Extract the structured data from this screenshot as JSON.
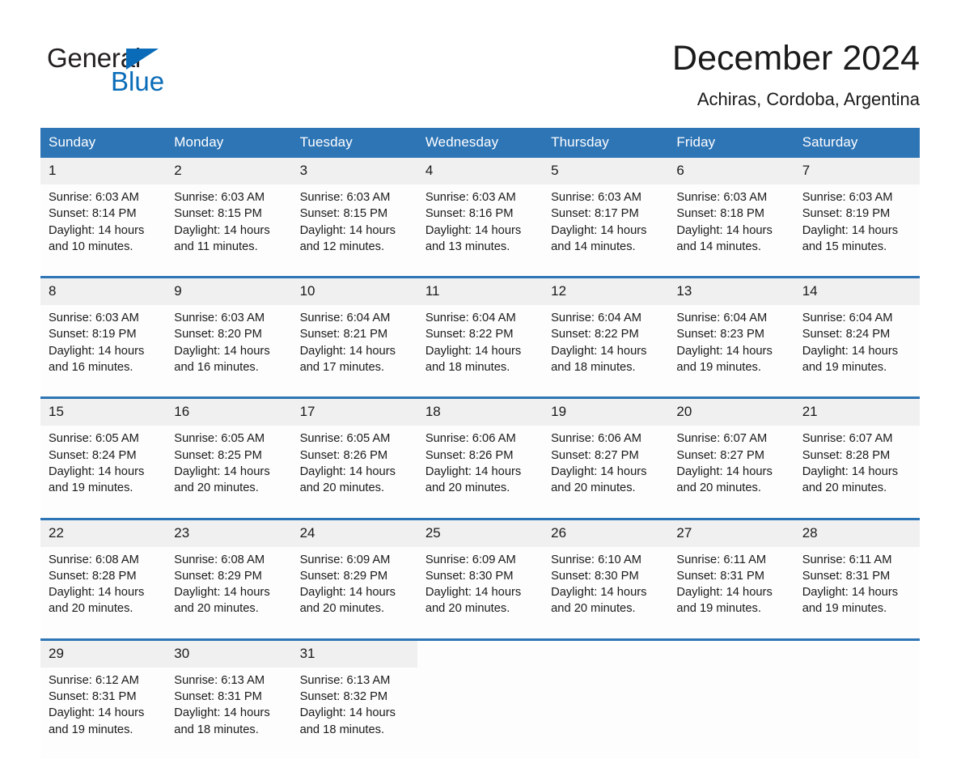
{
  "brand": {
    "word_one": "General",
    "word_two": "Blue",
    "triangle_icon": "triangle-icon",
    "accent_color": "#0a6cb8"
  },
  "header": {
    "month_title": "December 2024",
    "location": "Achiras, Cordoba, Argentina"
  },
  "theme": {
    "header_blue": "#2e75b6",
    "daynum_bg": "#f0f0f0",
    "cell_bg": "#fdfdfd",
    "text": "#1a1a1a"
  },
  "weekday_headers": [
    "Sunday",
    "Monday",
    "Tuesday",
    "Wednesday",
    "Thursday",
    "Friday",
    "Saturday"
  ],
  "weeks": [
    {
      "days": [
        {
          "num": "1",
          "sunrise": "Sunrise: 6:03 AM",
          "sunset": "Sunset: 8:14 PM",
          "daylight_1": "Daylight: 14 hours",
          "daylight_2": "and 10 minutes."
        },
        {
          "num": "2",
          "sunrise": "Sunrise: 6:03 AM",
          "sunset": "Sunset: 8:15 PM",
          "daylight_1": "Daylight: 14 hours",
          "daylight_2": "and 11 minutes."
        },
        {
          "num": "3",
          "sunrise": "Sunrise: 6:03 AM",
          "sunset": "Sunset: 8:15 PM",
          "daylight_1": "Daylight: 14 hours",
          "daylight_2": "and 12 minutes."
        },
        {
          "num": "4",
          "sunrise": "Sunrise: 6:03 AM",
          "sunset": "Sunset: 8:16 PM",
          "daylight_1": "Daylight: 14 hours",
          "daylight_2": "and 13 minutes."
        },
        {
          "num": "5",
          "sunrise": "Sunrise: 6:03 AM",
          "sunset": "Sunset: 8:17 PM",
          "daylight_1": "Daylight: 14 hours",
          "daylight_2": "and 14 minutes."
        },
        {
          "num": "6",
          "sunrise": "Sunrise: 6:03 AM",
          "sunset": "Sunset: 8:18 PM",
          "daylight_1": "Daylight: 14 hours",
          "daylight_2": "and 14 minutes."
        },
        {
          "num": "7",
          "sunrise": "Sunrise: 6:03 AM",
          "sunset": "Sunset: 8:19 PM",
          "daylight_1": "Daylight: 14 hours",
          "daylight_2": "and 15 minutes."
        }
      ]
    },
    {
      "days": [
        {
          "num": "8",
          "sunrise": "Sunrise: 6:03 AM",
          "sunset": "Sunset: 8:19 PM",
          "daylight_1": "Daylight: 14 hours",
          "daylight_2": "and 16 minutes."
        },
        {
          "num": "9",
          "sunrise": "Sunrise: 6:03 AM",
          "sunset": "Sunset: 8:20 PM",
          "daylight_1": "Daylight: 14 hours",
          "daylight_2": "and 16 minutes."
        },
        {
          "num": "10",
          "sunrise": "Sunrise: 6:04 AM",
          "sunset": "Sunset: 8:21 PM",
          "daylight_1": "Daylight: 14 hours",
          "daylight_2": "and 17 minutes."
        },
        {
          "num": "11",
          "sunrise": "Sunrise: 6:04 AM",
          "sunset": "Sunset: 8:22 PM",
          "daylight_1": "Daylight: 14 hours",
          "daylight_2": "and 18 minutes."
        },
        {
          "num": "12",
          "sunrise": "Sunrise: 6:04 AM",
          "sunset": "Sunset: 8:22 PM",
          "daylight_1": "Daylight: 14 hours",
          "daylight_2": "and 18 minutes."
        },
        {
          "num": "13",
          "sunrise": "Sunrise: 6:04 AM",
          "sunset": "Sunset: 8:23 PM",
          "daylight_1": "Daylight: 14 hours",
          "daylight_2": "and 19 minutes."
        },
        {
          "num": "14",
          "sunrise": "Sunrise: 6:04 AM",
          "sunset": "Sunset: 8:24 PM",
          "daylight_1": "Daylight: 14 hours",
          "daylight_2": "and 19 minutes."
        }
      ]
    },
    {
      "days": [
        {
          "num": "15",
          "sunrise": "Sunrise: 6:05 AM",
          "sunset": "Sunset: 8:24 PM",
          "daylight_1": "Daylight: 14 hours",
          "daylight_2": "and 19 minutes."
        },
        {
          "num": "16",
          "sunrise": "Sunrise: 6:05 AM",
          "sunset": "Sunset: 8:25 PM",
          "daylight_1": "Daylight: 14 hours",
          "daylight_2": "and 20 minutes."
        },
        {
          "num": "17",
          "sunrise": "Sunrise: 6:05 AM",
          "sunset": "Sunset: 8:26 PM",
          "daylight_1": "Daylight: 14 hours",
          "daylight_2": "and 20 minutes."
        },
        {
          "num": "18",
          "sunrise": "Sunrise: 6:06 AM",
          "sunset": "Sunset: 8:26 PM",
          "daylight_1": "Daylight: 14 hours",
          "daylight_2": "and 20 minutes."
        },
        {
          "num": "19",
          "sunrise": "Sunrise: 6:06 AM",
          "sunset": "Sunset: 8:27 PM",
          "daylight_1": "Daylight: 14 hours",
          "daylight_2": "and 20 minutes."
        },
        {
          "num": "20",
          "sunrise": "Sunrise: 6:07 AM",
          "sunset": "Sunset: 8:27 PM",
          "daylight_1": "Daylight: 14 hours",
          "daylight_2": "and 20 minutes."
        },
        {
          "num": "21",
          "sunrise": "Sunrise: 6:07 AM",
          "sunset": "Sunset: 8:28 PM",
          "daylight_1": "Daylight: 14 hours",
          "daylight_2": "and 20 minutes."
        }
      ]
    },
    {
      "days": [
        {
          "num": "22",
          "sunrise": "Sunrise: 6:08 AM",
          "sunset": "Sunset: 8:28 PM",
          "daylight_1": "Daylight: 14 hours",
          "daylight_2": "and 20 minutes."
        },
        {
          "num": "23",
          "sunrise": "Sunrise: 6:08 AM",
          "sunset": "Sunset: 8:29 PM",
          "daylight_1": "Daylight: 14 hours",
          "daylight_2": "and 20 minutes."
        },
        {
          "num": "24",
          "sunrise": "Sunrise: 6:09 AM",
          "sunset": "Sunset: 8:29 PM",
          "daylight_1": "Daylight: 14 hours",
          "daylight_2": "and 20 minutes."
        },
        {
          "num": "25",
          "sunrise": "Sunrise: 6:09 AM",
          "sunset": "Sunset: 8:30 PM",
          "daylight_1": "Daylight: 14 hours",
          "daylight_2": "and 20 minutes."
        },
        {
          "num": "26",
          "sunrise": "Sunrise: 6:10 AM",
          "sunset": "Sunset: 8:30 PM",
          "daylight_1": "Daylight: 14 hours",
          "daylight_2": "and 20 minutes."
        },
        {
          "num": "27",
          "sunrise": "Sunrise: 6:11 AM",
          "sunset": "Sunset: 8:31 PM",
          "daylight_1": "Daylight: 14 hours",
          "daylight_2": "and 19 minutes."
        },
        {
          "num": "28",
          "sunrise": "Sunrise: 6:11 AM",
          "sunset": "Sunset: 8:31 PM",
          "daylight_1": "Daylight: 14 hours",
          "daylight_2": "and 19 minutes."
        }
      ]
    },
    {
      "days": [
        {
          "num": "29",
          "sunrise": "Sunrise: 6:12 AM",
          "sunset": "Sunset: 8:31 PM",
          "daylight_1": "Daylight: 14 hours",
          "daylight_2": "and 19 minutes."
        },
        {
          "num": "30",
          "sunrise": "Sunrise: 6:13 AM",
          "sunset": "Sunset: 8:31 PM",
          "daylight_1": "Daylight: 14 hours",
          "daylight_2": "and 18 minutes."
        },
        {
          "num": "31",
          "sunrise": "Sunrise: 6:13 AM",
          "sunset": "Sunset: 8:32 PM",
          "daylight_1": "Daylight: 14 hours",
          "daylight_2": "and 18 minutes."
        },
        {
          "num": "",
          "sunrise": "",
          "sunset": "",
          "daylight_1": "",
          "daylight_2": ""
        },
        {
          "num": "",
          "sunrise": "",
          "sunset": "",
          "daylight_1": "",
          "daylight_2": ""
        },
        {
          "num": "",
          "sunrise": "",
          "sunset": "",
          "daylight_1": "",
          "daylight_2": ""
        },
        {
          "num": "",
          "sunrise": "",
          "sunset": "",
          "daylight_1": "",
          "daylight_2": ""
        }
      ]
    }
  ]
}
